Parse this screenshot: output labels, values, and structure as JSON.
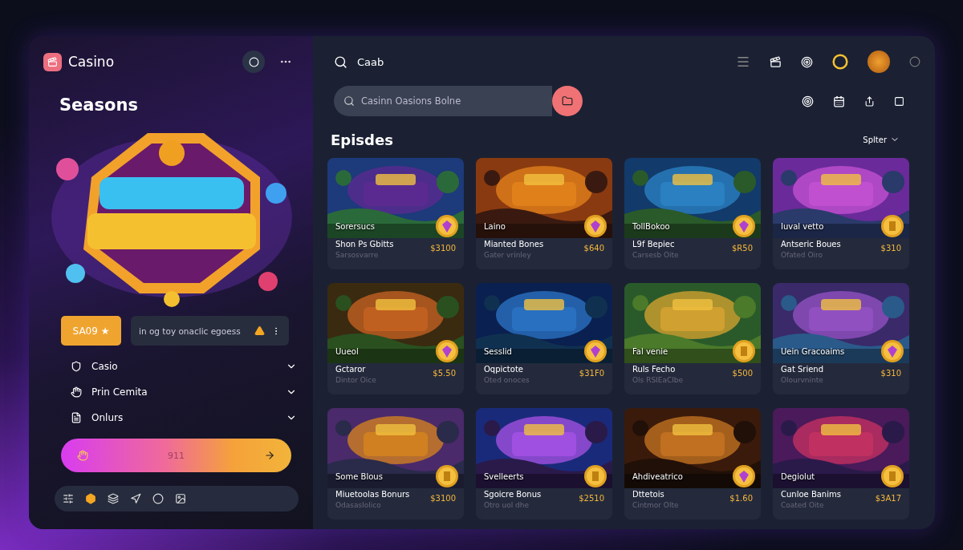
{
  "sidebar": {
    "brand": "Casino",
    "heading": "Seasons",
    "promo_button": "SA09 ★",
    "notice": "in og toy onaclic egoess",
    "items": [
      {
        "label": "Casio",
        "expanded": false
      },
      {
        "label": "Prin Cemita",
        "expanded": false
      },
      {
        "label": "Onlurs",
        "expanded": false
      }
    ],
    "action_button": "911",
    "bottom_bar": [
      {
        "selected": false
      },
      {
        "selected": true
      },
      {
        "selected": false
      },
      {
        "selected": false
      },
      {
        "selected": false
      },
      {
        "selected": false
      }
    ]
  },
  "topbar": {
    "search": "Caab"
  },
  "search": {
    "placeholder": "Casinn Oasions Bolne"
  },
  "section": {
    "title": "Episdes",
    "sort": "Splter"
  },
  "cards": [
    {
      "tag": "Sorersucs",
      "title": "Shon Ps Gbitts",
      "subtitle": "Sarsosvarre",
      "price": "$3100",
      "kind": "gem"
    },
    {
      "tag": "Laino",
      "title": "Mianted Bones",
      "subtitle": "Gater vrinley",
      "price": "$640",
      "kind": "gem"
    },
    {
      "tag": "TollBokoo",
      "title": "L9f Bepiec",
      "subtitle": "Carsesb Oite",
      "price": "$R50",
      "kind": "gem"
    },
    {
      "tag": "Iuval vetto",
      "title": "Antseric Boues",
      "subtitle": "Ofated Oiro",
      "price": "$310",
      "kind": "coin"
    },
    {
      "tag": "Uueol",
      "title": "Gctaror",
      "subtitle": "Dintor Oice",
      "price": "$5.50",
      "kind": "gem"
    },
    {
      "tag": "Sesslid",
      "title": "Oqpictote",
      "subtitle": "Oted onoces",
      "price": "$31F0",
      "kind": "gem"
    },
    {
      "tag": "Fal venie",
      "title": "Ruls Fecho",
      "subtitle": "Ols RSIEaClbe",
      "price": "$500",
      "kind": "coin"
    },
    {
      "tag": "Uein Gracoaims",
      "title": "Gat Sriend",
      "subtitle": "Olourvninte",
      "price": "$310",
      "kind": "gem"
    },
    {
      "tag": "Some Blous",
      "title": "Miuetoolas Bonurs",
      "subtitle": "Odasaslolico",
      "price": "$3100",
      "kind": "coin"
    },
    {
      "tag": "Svelleerts",
      "title": "Sgoicre Bonus",
      "subtitle": "Otro uol dhe",
      "price": "$2510",
      "kind": "coin"
    },
    {
      "tag": "Ahdiveatrico",
      "title": "Dttetois",
      "subtitle": "Cintmor Olte",
      "price": "$1.60",
      "kind": "gem"
    },
    {
      "tag": "Degiolut",
      "title": "Cunloe Banims",
      "subtitle": "Coated Oite",
      "price": "$3A17",
      "kind": "coin"
    }
  ]
}
